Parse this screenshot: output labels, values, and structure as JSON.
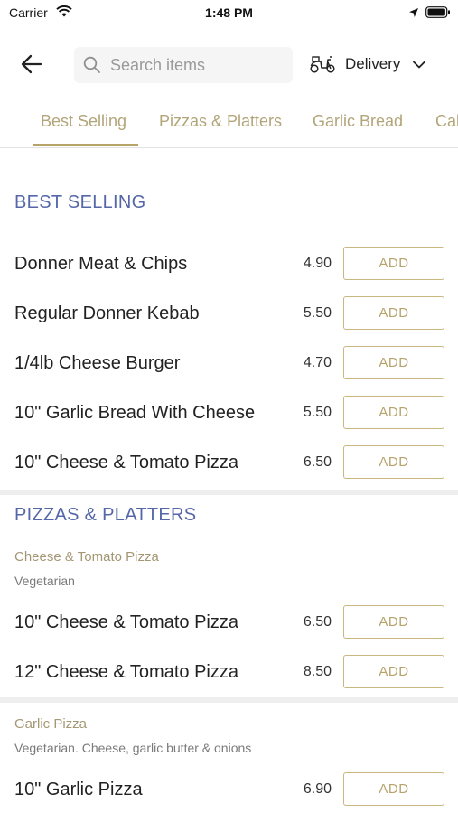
{
  "status": {
    "carrier": "Carrier",
    "time": "1:48 PM"
  },
  "header": {
    "search_placeholder": "Search items",
    "delivery_label": "Delivery"
  },
  "tabs": [
    {
      "label": "Best Selling",
      "active": true
    },
    {
      "label": "Pizzas & Platters",
      "active": false
    },
    {
      "label": "Garlic Bread",
      "active": false
    },
    {
      "label": "Cal",
      "active": false
    }
  ],
  "colors": {
    "accent_gold": "#b8a468",
    "section_blue": "#5567a8"
  },
  "sections": {
    "best_selling": {
      "title": "BEST SELLING",
      "items": [
        {
          "name": "Donner Meat & Chips",
          "price": "4.90",
          "action": "ADD"
        },
        {
          "name": "Regular Donner Kebab",
          "price": "5.50",
          "action": "ADD"
        },
        {
          "name": "1/4lb Cheese Burger",
          "price": "4.70",
          "action": "ADD"
        },
        {
          "name": "10\" Garlic Bread With Cheese",
          "price": "5.50",
          "action": "ADD"
        },
        {
          "name": "10\" Cheese & Tomato Pizza",
          "price": "6.50",
          "action": "ADD"
        }
      ]
    },
    "pizzas_platters": {
      "title": "PIZZAS & PLATTERS",
      "groups": [
        {
          "name": "Cheese & Tomato Pizza",
          "description": "Vegetarian",
          "items": [
            {
              "name": "10\" Cheese & Tomato Pizza",
              "price": "6.50",
              "action": "ADD"
            },
            {
              "name": "12\" Cheese & Tomato Pizza",
              "price": "8.50",
              "action": "ADD"
            }
          ]
        },
        {
          "name": "Garlic Pizza",
          "description": "Vegetarian. Cheese, garlic butter & onions",
          "items": [
            {
              "name": "10\" Garlic Pizza",
              "price": "6.90",
              "action": "ADD"
            }
          ]
        }
      ]
    }
  }
}
